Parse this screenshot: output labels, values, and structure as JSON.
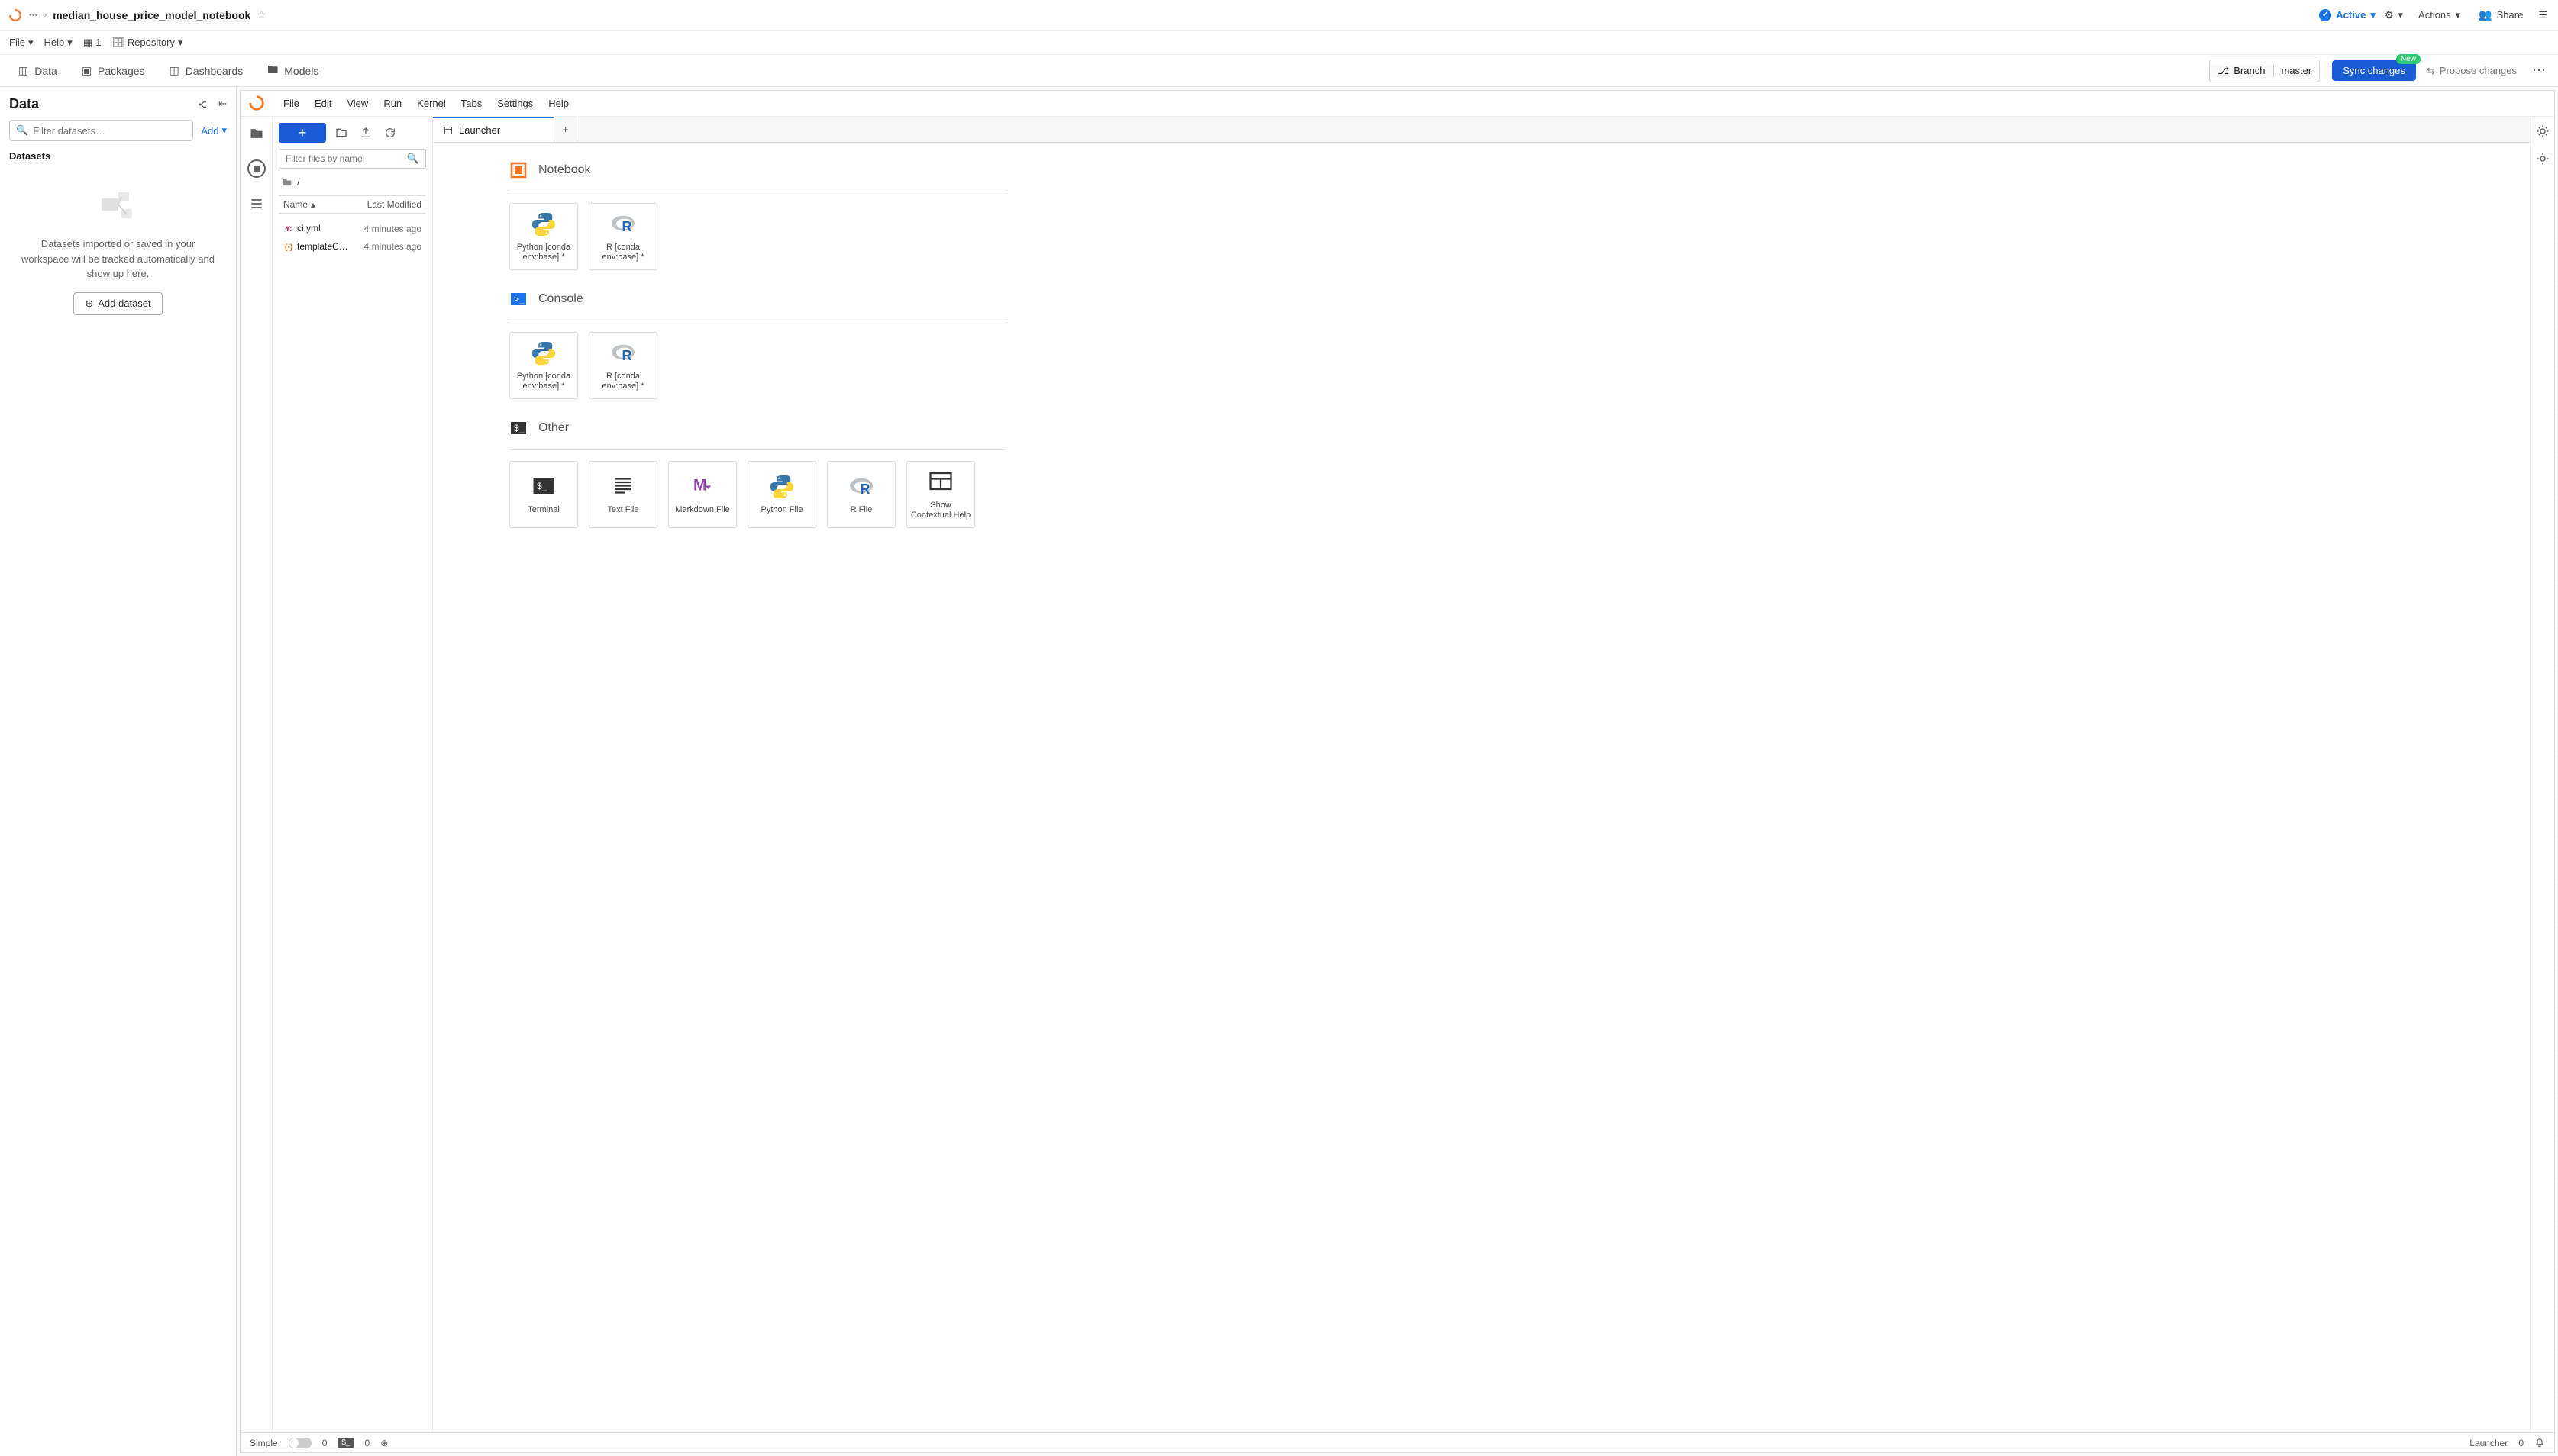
{
  "breadcrumb": {
    "title": "median_house_price_model_notebook"
  },
  "header1": {
    "active_label": "Active",
    "actions_label": "Actions",
    "share_label": "Share"
  },
  "header2": {
    "file": "File",
    "help": "Help",
    "badge_count": "1",
    "repository": "Repository"
  },
  "header3": {
    "tabs": [
      {
        "label": "Data"
      },
      {
        "label": "Packages"
      },
      {
        "label": "Dashboards"
      },
      {
        "label": "Models"
      }
    ],
    "branch_label": "Branch",
    "branch_name": "master",
    "sync_label": "Sync changes",
    "new_badge": "New",
    "propose_label": "Propose changes"
  },
  "data_panel": {
    "title": "Data",
    "filter_placeholder": "Filter datasets…",
    "add_label": "Add",
    "datasets_label": "Datasets",
    "empty_text": "Datasets imported or saved in your workspace will be tracked automatically and show up here.",
    "add_dataset_label": "Add dataset"
  },
  "jupyter": {
    "menus": [
      "File",
      "Edit",
      "View",
      "Run",
      "Kernel",
      "Tabs",
      "Settings",
      "Help"
    ],
    "filebrowser": {
      "search_placeholder": "Filter files by name",
      "path": "/",
      "col_name": "Name",
      "col_modified": "Last Modified",
      "files": [
        {
          "name": "ci.yml",
          "type": "yaml",
          "icon": "Y:",
          "modified": "4 minutes ago"
        },
        {
          "name": "templateC…",
          "type": "json",
          "icon": "{·}",
          "modified": "4 minutes ago"
        }
      ]
    },
    "tab": {
      "label": "Launcher"
    },
    "launcher": {
      "sections": [
        {
          "key": "notebook",
          "title": "Notebook",
          "cards": [
            {
              "key": "python",
              "label": "Python [conda env:base] *"
            },
            {
              "key": "r",
              "label": "R [conda env:base] *"
            }
          ]
        },
        {
          "key": "console",
          "title": "Console",
          "cards": [
            {
              "key": "python",
              "label": "Python [conda env:base] *"
            },
            {
              "key": "r",
              "label": "R [conda env:base] *"
            }
          ]
        },
        {
          "key": "other",
          "title": "Other",
          "cards": [
            {
              "key": "terminal",
              "label": "Terminal"
            },
            {
              "key": "text",
              "label": "Text File"
            },
            {
              "key": "markdown",
              "label": "Markdown File"
            },
            {
              "key": "pyfile",
              "label": "Python File"
            },
            {
              "key": "rfile",
              "label": "R File"
            },
            {
              "key": "ctxhelp",
              "label": "Show Contextual Help"
            }
          ]
        }
      ]
    },
    "statusbar": {
      "simple": "Simple",
      "count1": "0",
      "count2": "0",
      "right_label": "Launcher",
      "right_count": "0"
    }
  }
}
